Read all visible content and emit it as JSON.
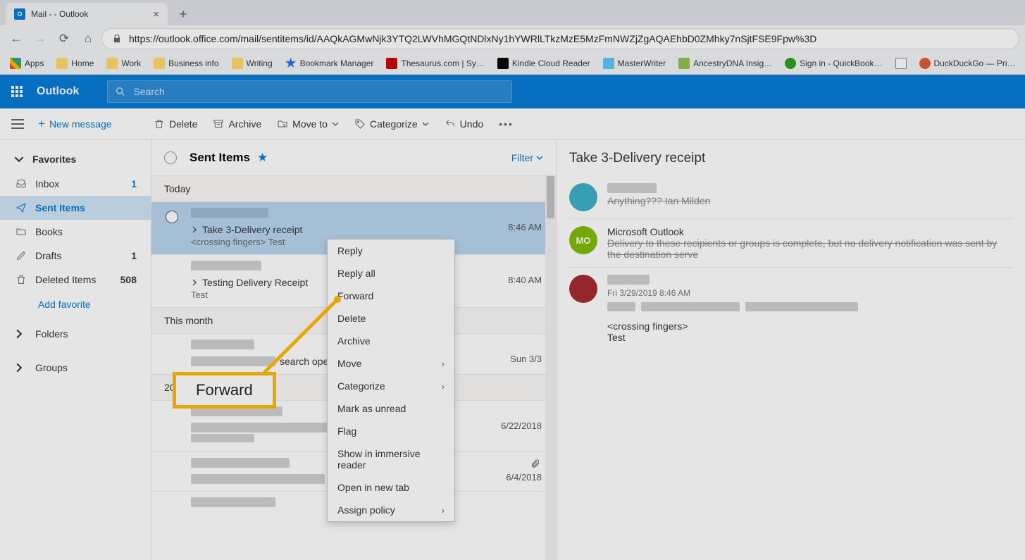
{
  "browser": {
    "tab_title": "Mail -                - Outlook",
    "url": "https://outlook.office.com/mail/sentitems/id/AAQkAGMwNjk3YTQ2LWVhMGQtNDlxNy1hYWRlLTkzMzE5MzFmNWZjZgAQAEhbD0ZMhky7nSjtFSE9Fpw%3D",
    "bookmarks": {
      "apps": "Apps",
      "home": "Home",
      "work": "Work",
      "business": "Business info",
      "writing": "Writing",
      "bookmark_manager": "Bookmark Manager",
      "thesaurus": "Thesaurus.com | Sy…",
      "kindle": "Kindle Cloud Reader",
      "masterwriter": "MasterWriter",
      "ancestry": "AncestryDNA Insig…",
      "quickbooks": "Sign in - QuickBook…",
      "duckduckgo": "DuckDuckGo — Pri…"
    }
  },
  "header": {
    "brand": "Outlook",
    "search_placeholder": "Search"
  },
  "cmd": {
    "new_message": "New message",
    "delete": "Delete",
    "archive": "Archive",
    "move_to": "Move to",
    "categorize": "Categorize",
    "undo": "Undo"
  },
  "nav": {
    "favorites": "Favorites",
    "inbox": "Inbox",
    "inbox_count": "1",
    "sent": "Sent Items",
    "books": "Books",
    "drafts": "Drafts",
    "drafts_count": "1",
    "deleted": "Deleted Items",
    "deleted_count": "508",
    "add_favorite": "Add favorite",
    "folders": "Folders",
    "groups": "Groups"
  },
  "list": {
    "title": "Sent Items",
    "filter": "Filter",
    "groups": {
      "today": "Today",
      "this_month": "This month",
      "y2018": "2018"
    },
    "items": [
      {
        "subject": "Take 3-Delivery receipt",
        "preview": "<crossing fingers> Test",
        "time": "8:46 AM"
      },
      {
        "subject": "Testing Delivery Receipt",
        "preview": "Test",
        "time": "8:40 AM"
      },
      {
        "subject": "search operator",
        "preview": "",
        "time": "Sun 3/3"
      },
      {
        "subject": "",
        "preview": "",
        "time": "6/22/2018"
      },
      {
        "subject": "",
        "preview": "",
        "time": "6/4/2018"
      }
    ]
  },
  "ctx": {
    "reply": "Reply",
    "reply_all": "Reply all",
    "forward": "Forward",
    "delete": "Delete",
    "archive": "Archive",
    "move": "Move",
    "categorize": "Categorize",
    "mark_unread": "Mark as unread",
    "flag": "Flag",
    "immersive": "Show in immersive reader",
    "open_new_tab": "Open in new tab",
    "assign_policy": "Assign policy"
  },
  "callout": {
    "label": "Forward"
  },
  "reading": {
    "subject": "Take 3-Delivery receipt",
    "row1_preview": "Anything??? Ian Milden",
    "row2_sender": "Microsoft Outlook",
    "row2_initials": "MO",
    "row2_preview": "Delivery to these recipients or groups is complete, but no delivery notification was sent by the destination serve",
    "row3_date": "Fri 3/29/2019 8:46 AM",
    "row3_body1": "<crossing fingers>",
    "row3_body2": "Test"
  }
}
